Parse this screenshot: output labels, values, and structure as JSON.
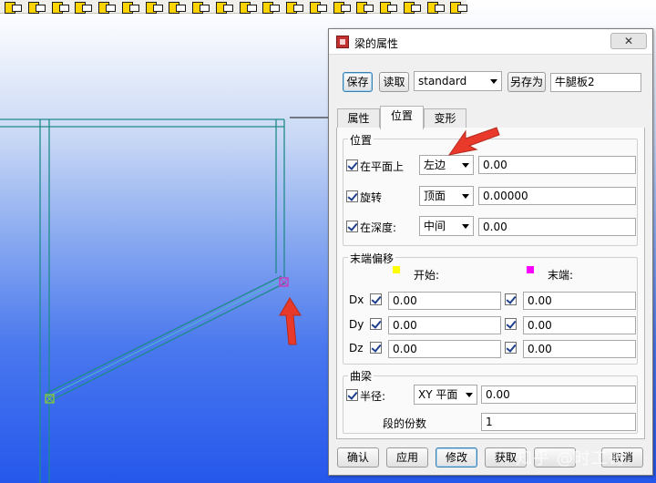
{
  "toolbar_icons": [
    "beam-tool-icon",
    "beam-tool-icon",
    "beam-tool-icon",
    "beam-tool-icon",
    "beam-tool-icon",
    "beam-tool-icon",
    "beam-tool-icon",
    "beam-tool-icon",
    "beam-tool-icon",
    "beam-tool-icon",
    "beam-tool-icon",
    "beam-tool-icon",
    "beam-tool-icon",
    "beam-tool-icon",
    "beam-tool-icon",
    "beam-tool-icon",
    "beam-tool-icon",
    "beam-tool-icon",
    "beam-tool-icon",
    "beam-tool-icon"
  ],
  "colors": {
    "model_line": "#1f8a8a",
    "start_handle": "#7cc04a",
    "end_handle": "#c040c0",
    "annotation_arrow": "#e8392b",
    "start_swatch": "#ffff00",
    "end_swatch": "#ff00ff"
  },
  "dialog": {
    "title": "梁的属性",
    "close_label": "",
    "top_row": {
      "save": "保存",
      "load": "读取",
      "preset_value": "standard",
      "save_as": "另存为",
      "save_as_name": "牛腿板2"
    },
    "tabs": [
      "属性",
      "位置",
      "变形"
    ],
    "active_tab": "位置",
    "position": {
      "group_title": "位置",
      "rows": [
        {
          "label": "在平面上",
          "checked": true,
          "option": "左边",
          "value": "0.00"
        },
        {
          "label": "旋转",
          "checked": true,
          "option": "顶面",
          "value": "0.00000"
        },
        {
          "label": "在深度:",
          "checked": true,
          "option": "中间",
          "value": "0.00"
        }
      ]
    },
    "end_offset": {
      "group_title": "末端偏移",
      "start_label": "开始:",
      "end_label": "末端:",
      "rows": [
        {
          "label": "Dx",
          "start_checked": true,
          "start_value": "0.00",
          "end_checked": true,
          "end_value": "0.00"
        },
        {
          "label": "Dy",
          "start_checked": true,
          "start_value": "0.00",
          "end_checked": true,
          "end_value": "0.00"
        },
        {
          "label": "Dz",
          "start_checked": true,
          "start_value": "0.00",
          "end_checked": true,
          "end_value": "0.00"
        }
      ]
    },
    "curved_beam": {
      "group_title": "曲梁",
      "radius_label": "半径:",
      "radius_checked": true,
      "plane_option": "XY 平面",
      "radius_value": "0.00",
      "segments_label": "段的份数",
      "segments_value": "1"
    },
    "bottom_buttons": {
      "ok": "确认",
      "apply": "应用",
      "modify": "修改",
      "get": "获取",
      "toggle": "",
      "cancel": "取消"
    }
  },
  "watermark": "知乎 @时工哥"
}
